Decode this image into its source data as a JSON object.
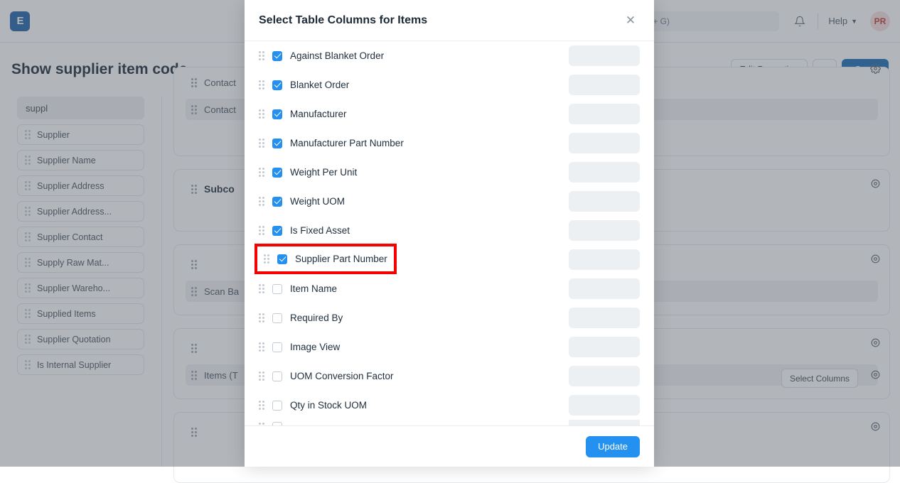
{
  "navbar": {
    "logo_text": "E",
    "logo_icon": "erpnext-logo-icon",
    "awesomebar_value": "command (Ctrl + G)",
    "bell_icon": "notification-bell-icon",
    "help_label": "Help",
    "chevron_icon": "chevron-down-icon",
    "avatar_initials": "PR"
  },
  "page": {
    "title": "Show supplier item code",
    "edit_properties_label": "Edit Properties",
    "more_label": "···",
    "save_label": "Save"
  },
  "sidebar": {
    "search_value": "suppl",
    "items": [
      {
        "label": "Supplier"
      },
      {
        "label": "Supplier Name"
      },
      {
        "label": "Supplier Address"
      },
      {
        "label": "Supplier Address..."
      },
      {
        "label": "Supplier Contact"
      },
      {
        "label": "Supply Raw Mat..."
      },
      {
        "label": "Supplier Wareho..."
      },
      {
        "label": "Supplied Items"
      },
      {
        "label": "Supplier Quotation"
      },
      {
        "label": "Is Internal Supplier"
      }
    ]
  },
  "form_sections": [
    {
      "rows": [
        {
          "label": "Contact",
          "filled": false
        },
        {
          "label": "Contact",
          "filled": true
        }
      ],
      "gear": true,
      "gear_rows": 1
    },
    {
      "rows": [
        {
          "label": "Subco",
          "filled": false,
          "bold": true
        }
      ],
      "gear": true
    },
    {
      "rows": [
        {
          "label": "",
          "filled": false
        },
        {
          "label": "Scan Ba",
          "filled": true
        }
      ],
      "gear": true
    },
    {
      "rows": [
        {
          "label": "",
          "filled": false
        },
        {
          "label": "Items (T",
          "filled": true
        }
      ],
      "gear": true,
      "button": "Select Columns"
    },
    {
      "rows": [
        {
          "label": "",
          "filled": false
        }
      ],
      "gear": true
    }
  ],
  "modal": {
    "title": "Select Table Columns for Items",
    "close_icon": "close-icon",
    "update_label": "Update",
    "columns": [
      {
        "label": "Against Blanket Order",
        "checked": true,
        "width": ""
      },
      {
        "label": "Blanket Order",
        "checked": true,
        "width": ""
      },
      {
        "label": "Manufacturer",
        "checked": true,
        "width": ""
      },
      {
        "label": "Manufacturer Part Number",
        "checked": true,
        "width": ""
      },
      {
        "label": "Weight Per Unit",
        "checked": true,
        "width": ""
      },
      {
        "label": "Weight UOM",
        "checked": true,
        "width": ""
      },
      {
        "label": "Is Fixed Asset",
        "checked": true,
        "width": ""
      },
      {
        "label": "Supplier Part Number",
        "checked": true,
        "width": ""
      },
      {
        "label": "Item Name",
        "checked": false,
        "width": ""
      },
      {
        "label": "Required By",
        "checked": false,
        "width": ""
      },
      {
        "label": "Image View",
        "checked": false,
        "width": ""
      },
      {
        "label": "UOM Conversion Factor",
        "checked": false,
        "width": ""
      },
      {
        "label": "Qty in Stock UOM",
        "checked": false,
        "width": ""
      }
    ]
  },
  "highlight": {
    "target_label": "Supplier Part Number",
    "color": "#f70000"
  },
  "colors": {
    "accent_blue": "#2490ef",
    "save_blue": "#1268b3",
    "highlight_red": "#f70000",
    "logo_blue": "#1b5fa8"
  }
}
